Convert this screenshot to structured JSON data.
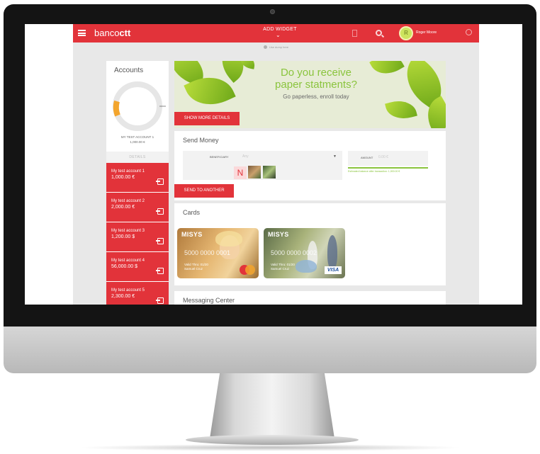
{
  "topbar": {
    "brand_prefix": "banco",
    "brand_suffix": "ctt",
    "add_widget": "ADD WIDGET",
    "user_name": "Roger Moore",
    "avatar_initial": "R"
  },
  "subheader": {
    "text": "Use dump here"
  },
  "accounts": {
    "title": "Accounts",
    "gauge_label": "MY TEST ACCOUNT 1",
    "gauge_value": "1,000.00 €",
    "details": "DETAILS",
    "items": [
      {
        "name": "My test account 1",
        "amount": "1,000.00 €"
      },
      {
        "name": "My test account 2",
        "amount": "2,000.00 €"
      },
      {
        "name": "My test account 3",
        "amount": "1,200.00 $"
      },
      {
        "name": "My test account 4",
        "amount": "56,000.00 $"
      },
      {
        "name": "My test account 5",
        "amount": "2,300.00 €"
      }
    ]
  },
  "banner": {
    "line1": "Do you receive",
    "line2": "paper statments?",
    "line3": "Go paperless, enroll today",
    "button": "SHOW MORE DETAILS"
  },
  "send_money": {
    "title": "Send Money",
    "beneficiary_label": "BENEFICIARY",
    "beneficiary_value": "Any",
    "amount_label": "AMOUNT",
    "amount_value": "0.00 €",
    "balance_note": "Estimated balance after transaction: 1,000.00 €",
    "contact_initial": "N",
    "button": "SEND TO ANOTHER"
  },
  "cards": {
    "title": "Cards",
    "items": [
      {
        "brand": "MISYS",
        "number": "5000 0000 0001",
        "valid": "Valid Thru: 01/20",
        "holder": "Samuel Cruz",
        "network": "MasterCard"
      },
      {
        "brand": "MISYS",
        "number": "5000 0000 0002",
        "valid": "Valid Thru: 01/20",
        "holder": "Samuel Cruz",
        "network": "VISA"
      }
    ]
  },
  "messaging": {
    "title": "Messaging Center"
  },
  "colors": {
    "brand_red": "#e2333a",
    "accent_green": "#8ac43d",
    "gauge_orange": "#f3a52d"
  }
}
